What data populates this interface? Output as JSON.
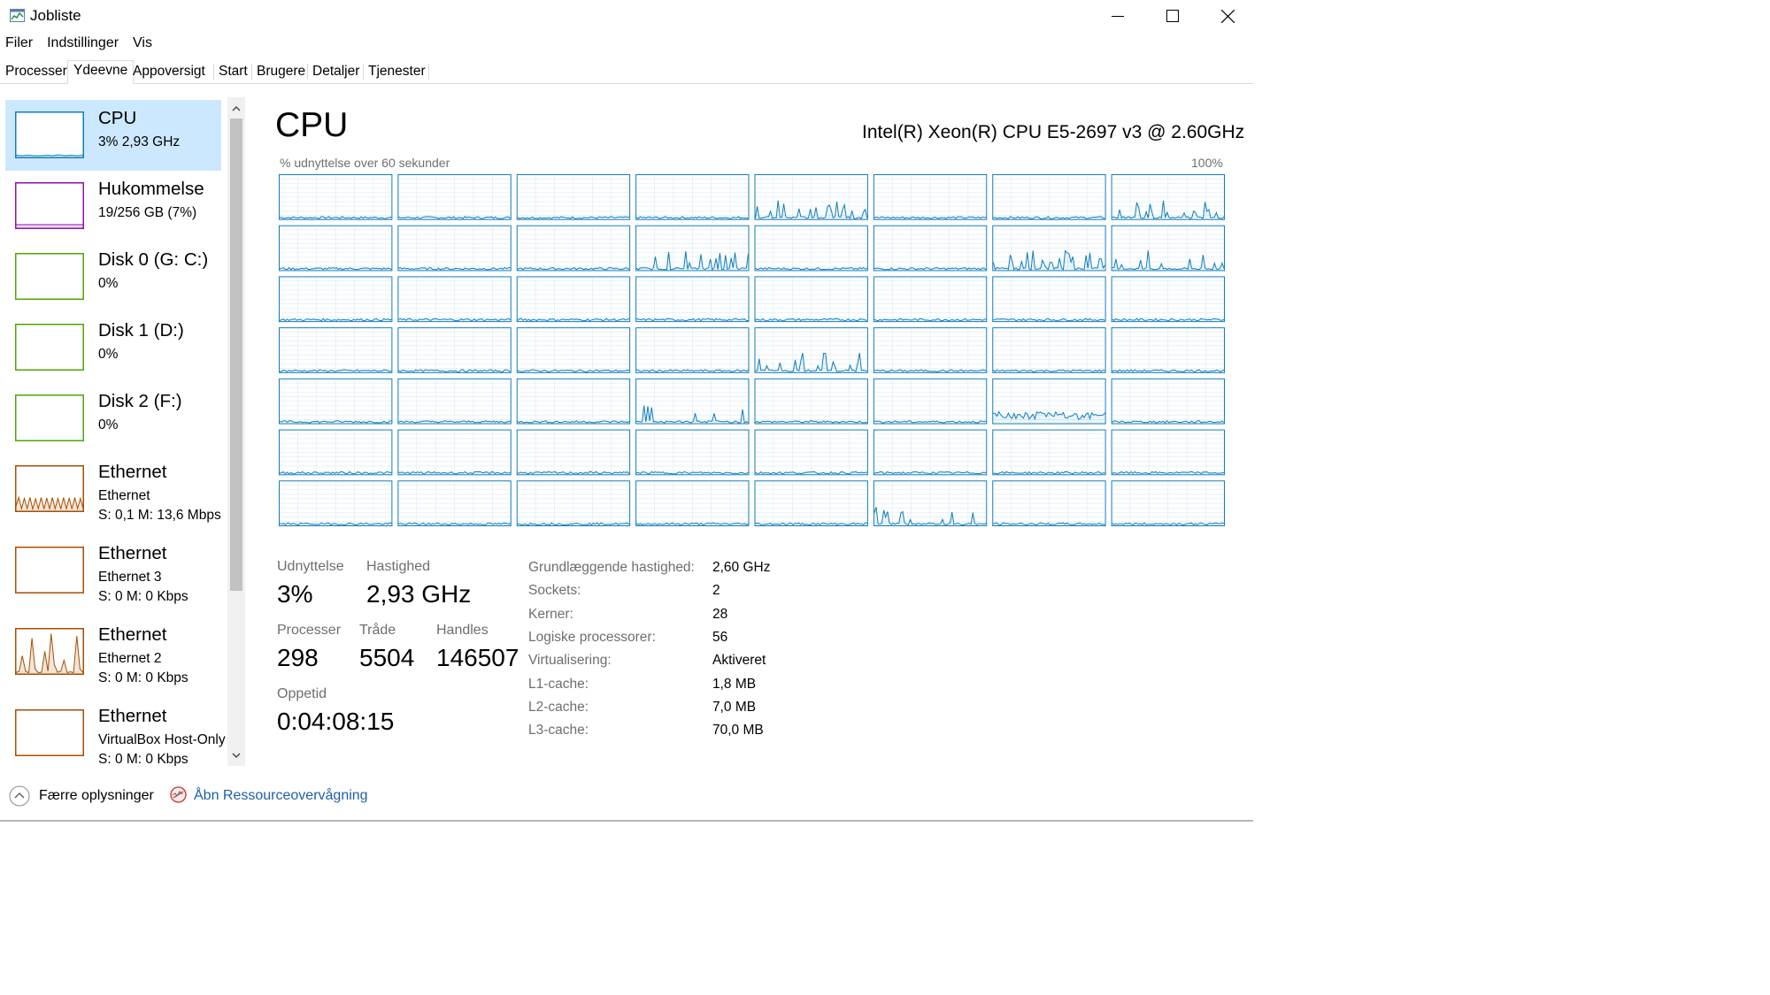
{
  "window": {
    "title": "Jobliste",
    "controls": {
      "minimize": "minimize-icon",
      "maximize": "maximize-icon",
      "close": "close-icon"
    }
  },
  "menu": [
    "Filer",
    "Indstillinger",
    "Vis"
  ],
  "tabs": [
    {
      "label": "Processer",
      "selected": false
    },
    {
      "label": "Ydeevne",
      "selected": true
    },
    {
      "label": "Appoversigt",
      "selected": false
    },
    {
      "label": "Start",
      "selected": false
    },
    {
      "label": "Brugere",
      "selected": false
    },
    {
      "label": "Detaljer",
      "selected": false
    },
    {
      "label": "Tjenester",
      "selected": false
    }
  ],
  "sidebar": {
    "items": [
      {
        "title": "CPU",
        "line1": "3%  2,93 GHz",
        "line2": "",
        "color": "#117dbb",
        "selected": true,
        "spark": [
          0.04,
          0.03,
          0.04,
          0.03,
          0.03,
          0.04,
          0.03,
          0.05,
          0.03,
          0.04,
          0.03,
          0.04
        ]
      },
      {
        "title": "Hukommelse",
        "line1": "19/256 GB (7%)",
        "line2": "",
        "color": "#8b12ae",
        "selected": false,
        "spark": [
          0.07,
          0.07,
          0.07,
          0.07,
          0.07,
          0.07,
          0.07,
          0.07
        ]
      },
      {
        "title": "Disk 0 (G: C:)",
        "line1": "0%",
        "line2": "",
        "color": "#4da60c",
        "selected": false,
        "spark": []
      },
      {
        "title": "Disk 1 (D:)",
        "line1": "0%",
        "line2": "",
        "color": "#4da60c",
        "selected": false,
        "spark": []
      },
      {
        "title": "Disk 2 (F:)",
        "line1": "0%",
        "line2": "",
        "color": "#4da60c",
        "selected": false,
        "spark": []
      },
      {
        "title": "Ethernet",
        "line1": "Ethernet",
        "line2": "S: 0,1  M: 13,6 Mbps",
        "color": "#a74f01",
        "selected": false,
        "spark": [
          0.1,
          0.3,
          0.05,
          0.28,
          0.05,
          0.3,
          0.04,
          0.27,
          0.05,
          0.3,
          0.04,
          0.29,
          0.05,
          0.3,
          0.05,
          0.28,
          0.04,
          0.3,
          0.05,
          0.29,
          0.04,
          0.3,
          0.05,
          0.28,
          0.05
        ]
      },
      {
        "title": "Ethernet",
        "line1": "Ethernet 3",
        "line2": "S: 0  M: 0 Kbps",
        "color": "#a74f01",
        "selected": false,
        "spark": []
      },
      {
        "title": "Ethernet",
        "line1": "Ethernet 2",
        "line2": "S: 0  M: 0 Kbps",
        "color": "#a74f01",
        "selected": false,
        "spark": [
          0.02,
          0.05,
          0.4,
          0.05,
          0.02,
          0.8,
          0.1,
          0.02,
          0.03,
          0.5,
          0.05,
          0.9,
          0.2,
          0.03,
          0.05,
          0.3,
          0.02,
          0.04,
          0.02,
          0.85,
          0.1,
          0.02
        ]
      },
      {
        "title": "Ethernet",
        "line1": "VirtualBox Host-Only",
        "line2": "S: 0  M: 0 Kbps",
        "color": "#a74f01",
        "selected": false,
        "spark": []
      }
    ]
  },
  "cpu": {
    "title": "CPU",
    "model": "Intel(R) Xeon(R) CPU E5-2697 v3 @ 2.60GHz",
    "axis_label": "% udnyttelse over 60 sekunder",
    "axis_max": "100%",
    "logical_cores": 56,
    "stats": {
      "utilization_label": "Udnyttelse",
      "utilization": "3%",
      "speed_label": "Hastighed",
      "speed": "2,93 GHz",
      "processes_label": "Processer",
      "processes": "298",
      "threads_label": "Tråde",
      "threads": "5504",
      "handles_label": "Handles",
      "handles": "146507",
      "uptime_label": "Oppetid",
      "uptime": "0:04:08:15"
    },
    "specs": [
      {
        "label": "Grundlæggende hastighed:",
        "value": "2,60 GHz"
      },
      {
        "label": "Sockets:",
        "value": "2"
      },
      {
        "label": "Kerner:",
        "value": "28"
      },
      {
        "label": "Logiske processorer:",
        "value": "56"
      },
      {
        "label": "Virtualisering:",
        "value": "Aktiveret"
      },
      {
        "label": "L1-cache:",
        "value": "1,8 MB"
      },
      {
        "label": "L2-cache:",
        "value": "7,0 MB"
      },
      {
        "label": "L3-cache:",
        "value": "70,0 MB"
      }
    ]
  },
  "footer": {
    "fewer_details": "Færre oplysninger",
    "open_monitor": "Åbn Ressourceovervågning"
  },
  "colors": {
    "cpu_line": "#117dbb",
    "cpu_grid": "#d9eaf4",
    "selected_bg": "#cce8ff",
    "link": "#1d5fa8"
  }
}
